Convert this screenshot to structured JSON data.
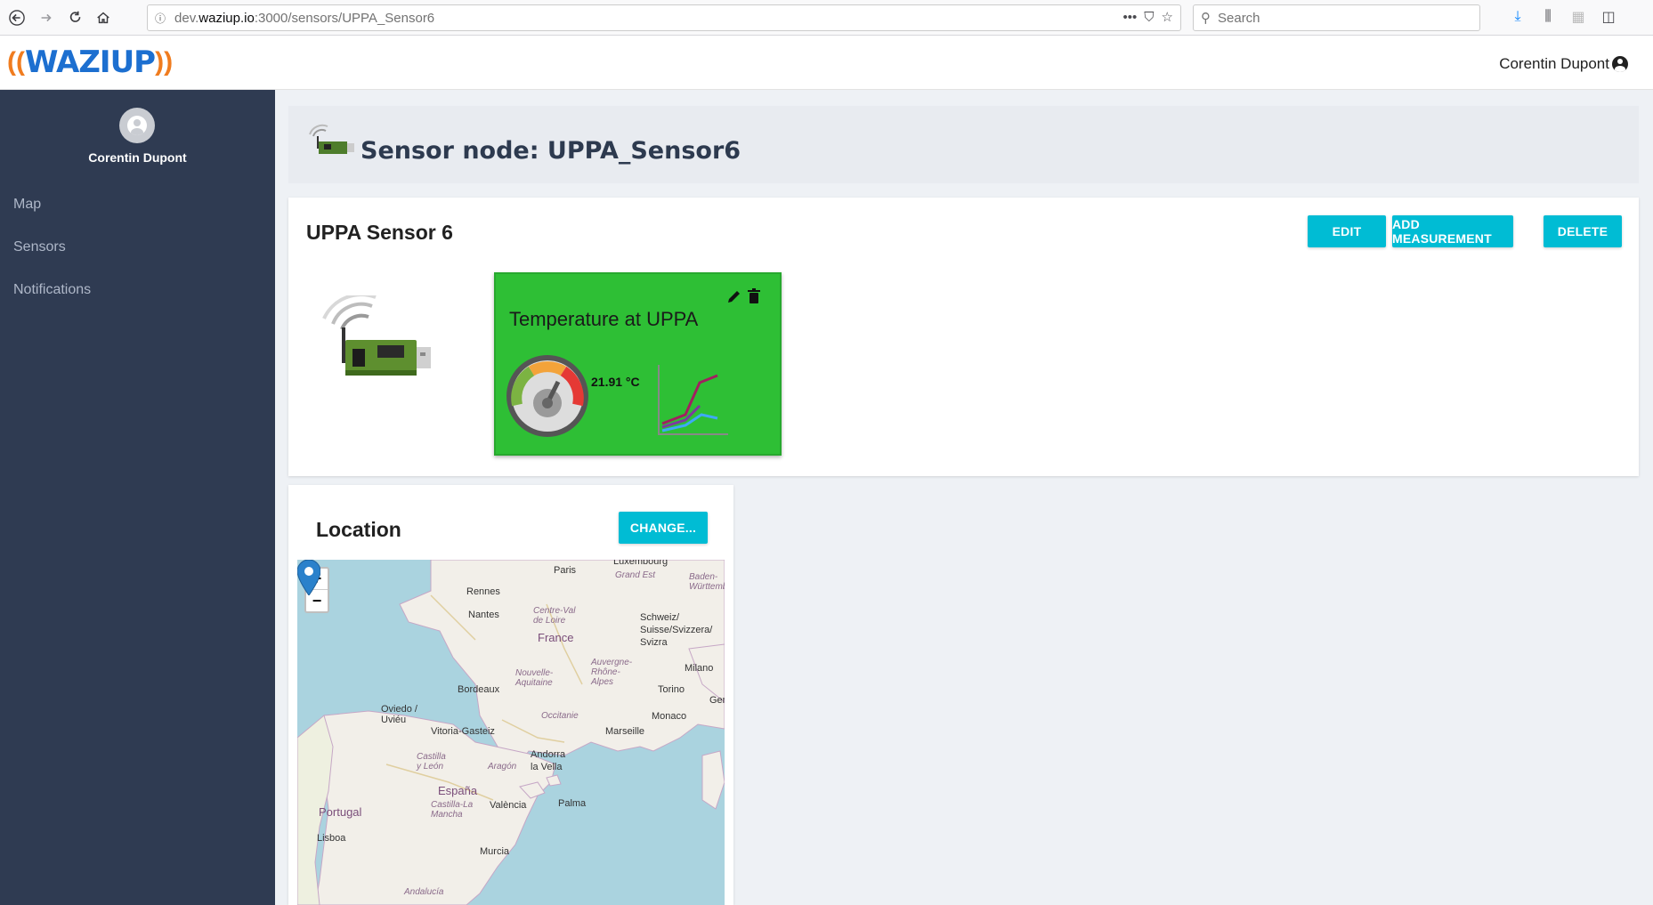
{
  "browser": {
    "url_prefix": "dev.",
    "url_host": "waziup.io",
    "url_path": ":3000/sensors/UPPA_Sensor6",
    "search_placeholder": "Search"
  },
  "header": {
    "logo_text": "WAZIUP",
    "user_name": "Corentin Dupont"
  },
  "sidebar": {
    "user_name": "Corentin Dupont",
    "items": [
      {
        "label": "Map"
      },
      {
        "label": "Sensors"
      },
      {
        "label": "Notifications"
      }
    ]
  },
  "page": {
    "title": "Sensor node: UPPA_Sensor6"
  },
  "sensor": {
    "name": "UPPA Sensor 6",
    "buttons": {
      "edit": "EDIT",
      "add_measurement": "ADD MEASUREMENT",
      "delete": "DELETE"
    },
    "measurement": {
      "name": "Temperature at UPPA",
      "value": "21.91 °C"
    }
  },
  "location": {
    "title": "Location",
    "change_button": "CHANGE...",
    "zoom_in": "+",
    "zoom_out": "−",
    "map_labels": {
      "paris": "Paris",
      "luxembourg": "Luxembourg",
      "grand_est": "Grand Est",
      "baden": "Baden-Württemberg",
      "rennes": "Rennes",
      "nantes": "Nantes",
      "centre": "Centre-Val de Loire",
      "france": "France",
      "schweiz": "Schweiz/ Suisse/Svizzera/ Svizra",
      "auvergne": "Auvergne-Rhône-Alpes",
      "nouvelle": "Nouvelle-Aquitaine",
      "milano": "Milano",
      "bordeaux": "Bordeaux",
      "torino": "Torino",
      "genova": "Genc",
      "oviedo": "Oviedo / Uviéu",
      "occitanie": "Occitanie",
      "monaco": "Monaco",
      "vitoria": "Vitoria-Gasteiz",
      "marseille": "Marseille",
      "andorra": "Andorra la Vella",
      "castilla_leon": "Castilla y León",
      "aragon": "Aragón",
      "espana": "España",
      "portugal": "Portugal",
      "castilla_mancha": "Castilla-La Mancha",
      "valencia": "València",
      "palma": "Palma",
      "lisboa": "Lisboa",
      "murcia": "Murcia",
      "andalucia": "Andalucía"
    }
  }
}
